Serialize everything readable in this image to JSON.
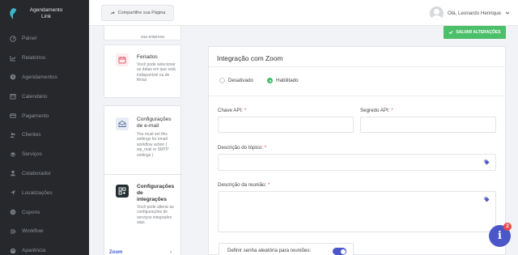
{
  "brand": {
    "line1": "Agendamento",
    "line2": "Link"
  },
  "sidebar": {
    "items": [
      {
        "label": "Painel",
        "icon": "dashboard-icon"
      },
      {
        "label": "Relatórios",
        "icon": "chart-icon"
      },
      {
        "label": "Agendamentos",
        "icon": "clock-icon"
      },
      {
        "label": "Calendário",
        "icon": "calendar-icon"
      },
      {
        "label": "Pagamento",
        "icon": "card-icon"
      },
      {
        "label": "Clientes",
        "icon": "users-icon"
      },
      {
        "label": "Serviços",
        "icon": "layers-icon"
      },
      {
        "label": "Colaborador",
        "icon": "user-icon"
      },
      {
        "label": "Localizações",
        "icon": "location-arrow-icon"
      },
      {
        "label": "Cupons",
        "icon": "coupon-icon"
      },
      {
        "label": "Workflow",
        "icon": "workflow-icon"
      },
      {
        "label": "Aparência",
        "icon": "palette-icon"
      }
    ]
  },
  "topbar": {
    "share_label": "Compartilhe sua Página",
    "user_greeting": "Olá, Leonardo Henrique"
  },
  "cards": {
    "top_fragment": "sua empresa",
    "holidays": {
      "title": "Feriados",
      "desc": "Você pode selecionar as datas em que está indisponível ou de férias"
    },
    "email": {
      "title_line1": "Configurações",
      "title_line2": "de e-mail",
      "desc": "You must set this settings for email workflow action ( wp_mail or SMTP settings )"
    },
    "integrations": {
      "title_line1": "Configurações",
      "title_line2": "de",
      "title_line3": "integrações",
      "desc": "Você pode alterar as configurações de serviços integrados aqui."
    },
    "zoom_link": "Zoom",
    "zoom_chevron": "›"
  },
  "main": {
    "save_label": "SALVAR ALTERAÇÕES",
    "panel_title": "Integração com Zoom",
    "radio_disabled": "Desativado",
    "radio_enabled": "Habilitado",
    "selected_radio": "Habilitado",
    "api_key_label": "Chave API:",
    "api_secret_label": "Segredo API:",
    "required_mark": "*",
    "topic_label": "Descrição do tópico:",
    "meeting_label": "Descrição da reunião:",
    "random_password_label": "Definir senha aleatória para reuniões:",
    "random_password_on": true
  },
  "help": {
    "glyph": "i",
    "badge": "2"
  },
  "colors": {
    "sidebar_bg": "#26282c",
    "accent": "#4b57c9",
    "save_green": "#4cbf6b",
    "radio_green": "#3fbf6a",
    "badge_red": "#e94b4b"
  }
}
